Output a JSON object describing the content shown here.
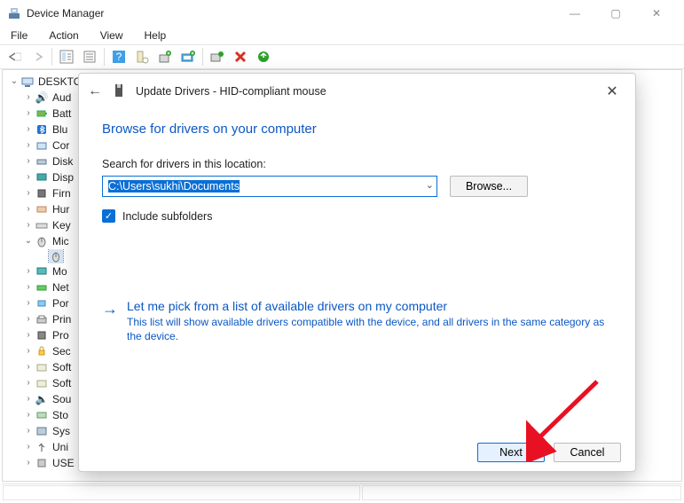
{
  "window": {
    "title": "Device Manager",
    "menus": [
      "File",
      "Action",
      "View",
      "Help"
    ],
    "winbuttons": {
      "min": "—",
      "max": "▢",
      "close": "✕"
    }
  },
  "tree": {
    "root": "DESKTO",
    "items": [
      {
        "i": "aud",
        "t": "Aud"
      },
      {
        "i": "bat",
        "t": "Batt"
      },
      {
        "i": "bt",
        "t": "Blu"
      },
      {
        "i": "com",
        "t": "Cor"
      },
      {
        "i": "disk",
        "t": "Disk"
      },
      {
        "i": "disp",
        "t": "Disp"
      },
      {
        "i": "firm",
        "t": "Firn"
      },
      {
        "i": "hid",
        "t": "Hur"
      },
      {
        "i": "key",
        "t": "Key"
      },
      {
        "i": "mice",
        "t": "Mic"
      },
      {
        "i": "mon",
        "t": "Mo"
      },
      {
        "i": "net",
        "t": "Net"
      },
      {
        "i": "port",
        "t": "Por"
      },
      {
        "i": "print",
        "t": "Prin"
      },
      {
        "i": "proc",
        "t": "Pro"
      },
      {
        "i": "sec",
        "t": "Sec"
      },
      {
        "i": "soft1",
        "t": "Soft"
      },
      {
        "i": "soft2",
        "t": "Soft"
      },
      {
        "i": "sound",
        "t": "Sou"
      },
      {
        "i": "stor",
        "t": "Sto"
      },
      {
        "i": "sys",
        "t": "Sys"
      },
      {
        "i": "usb",
        "t": "Uni"
      },
      {
        "i": "usbc",
        "t": "USE"
      }
    ]
  },
  "dialog": {
    "header": "Update Drivers - HID-compliant mouse",
    "heading": "Browse for drivers on your computer",
    "search_label": "Search for drivers in this location:",
    "path_value": "C:\\Users\\sukhi\\Documents",
    "browse_label": "Browse...",
    "include_subfolders_label": "Include subfolders",
    "include_subfolders_checked": true,
    "option_title": "Let me pick from a list of available drivers on my computer",
    "option_sub": "This list will show available drivers compatible with the device, and all drivers in the same category as the device.",
    "next": "Next",
    "cancel": "Cancel"
  }
}
